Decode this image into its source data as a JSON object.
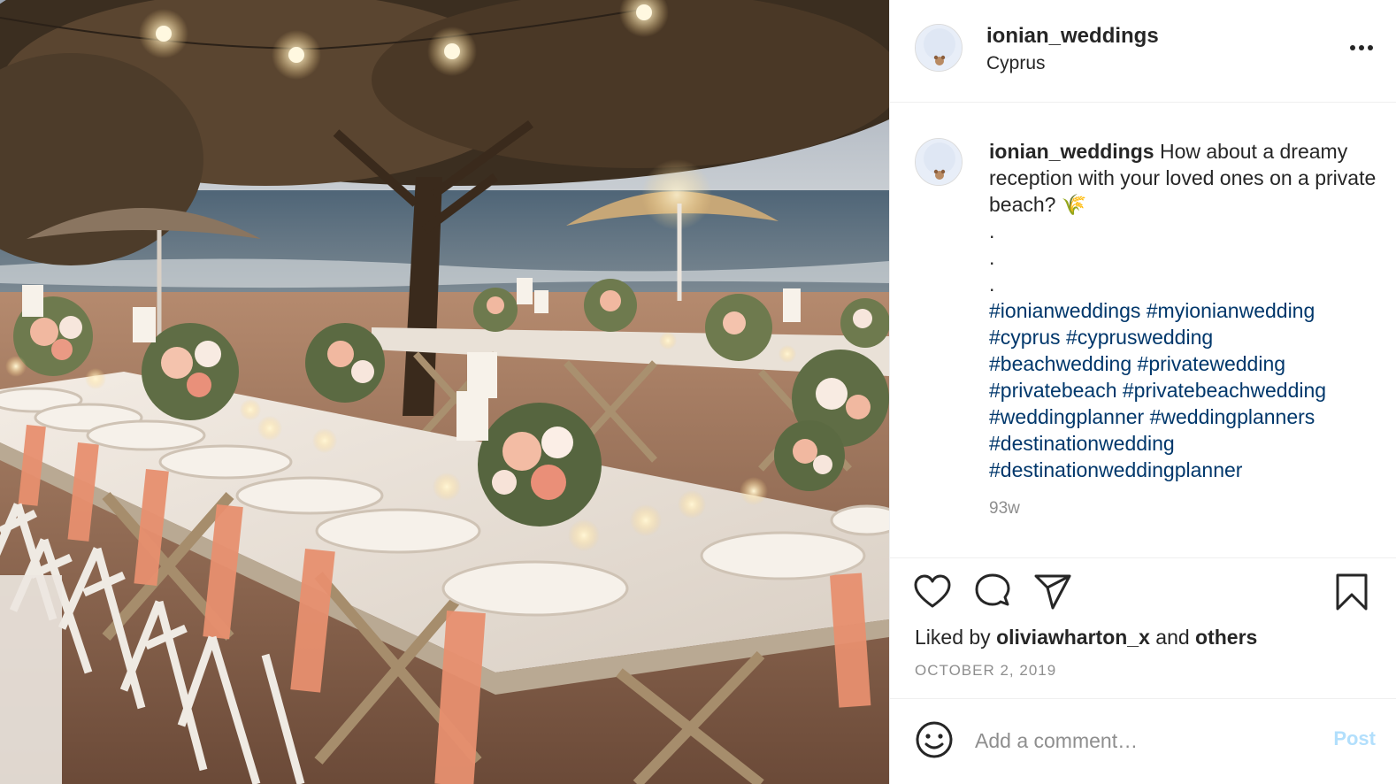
{
  "post": {
    "username": "ionian_weddings",
    "location": "Cyprus",
    "caption_text": "How about a dreamy reception with your loved ones on a private beach? 🌾",
    "caption_dots": [
      ".",
      ".",
      "."
    ],
    "hashtags": [
      "#ionianweddings",
      "#myionianwedding",
      "#cyprus",
      "#cypruswedding",
      "#beachwedding",
      "#privatewedding",
      "#privatebeach",
      "#privatebeachwedding",
      "#weddingplanner",
      "#weddingplanners",
      "#destinationwedding",
      "#destinationweddingplanner"
    ],
    "time_ago": "93w",
    "liked_by_prefix": "Liked by",
    "liked_by_user": "oliviawharton_x",
    "liked_by_and": "and",
    "liked_by_others": "others",
    "date": "OCTOBER 2, 2019"
  },
  "comment": {
    "placeholder": "Add a comment…",
    "post_label": "Post"
  },
  "icons": {
    "more": "more-options-icon",
    "like": "heart-icon",
    "comment": "comment-bubble-icon",
    "share": "paper-plane-icon",
    "save": "bookmark-icon",
    "emoji": "smiley-icon"
  },
  "colors": {
    "hashtag": "#00376b",
    "muted": "#8e8e8e",
    "post_button": "#b2dffc",
    "border": "#efefef"
  }
}
